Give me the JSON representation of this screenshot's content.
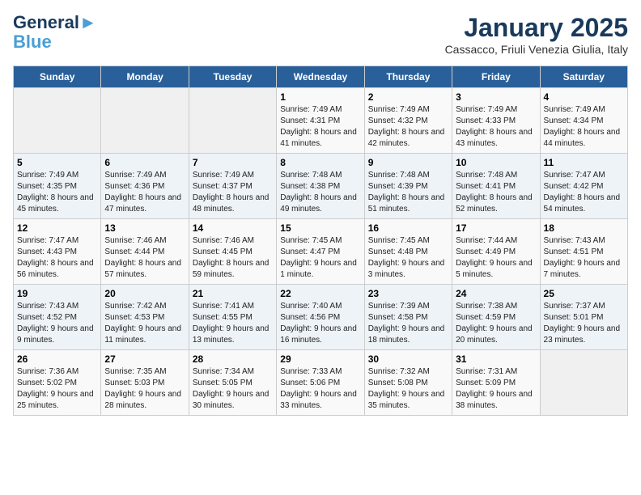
{
  "header": {
    "logo_line1": "General",
    "logo_line2": "Blue",
    "month": "January 2025",
    "location": "Cassacco, Friuli Venezia Giulia, Italy"
  },
  "days_of_week": [
    "Sunday",
    "Monday",
    "Tuesday",
    "Wednesday",
    "Thursday",
    "Friday",
    "Saturday"
  ],
  "weeks": [
    [
      {
        "day": "",
        "info": ""
      },
      {
        "day": "",
        "info": ""
      },
      {
        "day": "",
        "info": ""
      },
      {
        "day": "1",
        "info": "Sunrise: 7:49 AM\nSunset: 4:31 PM\nDaylight: 8 hours and 41 minutes."
      },
      {
        "day": "2",
        "info": "Sunrise: 7:49 AM\nSunset: 4:32 PM\nDaylight: 8 hours and 42 minutes."
      },
      {
        "day": "3",
        "info": "Sunrise: 7:49 AM\nSunset: 4:33 PM\nDaylight: 8 hours and 43 minutes."
      },
      {
        "day": "4",
        "info": "Sunrise: 7:49 AM\nSunset: 4:34 PM\nDaylight: 8 hours and 44 minutes."
      }
    ],
    [
      {
        "day": "5",
        "info": "Sunrise: 7:49 AM\nSunset: 4:35 PM\nDaylight: 8 hours and 45 minutes."
      },
      {
        "day": "6",
        "info": "Sunrise: 7:49 AM\nSunset: 4:36 PM\nDaylight: 8 hours and 47 minutes."
      },
      {
        "day": "7",
        "info": "Sunrise: 7:49 AM\nSunset: 4:37 PM\nDaylight: 8 hours and 48 minutes."
      },
      {
        "day": "8",
        "info": "Sunrise: 7:48 AM\nSunset: 4:38 PM\nDaylight: 8 hours and 49 minutes."
      },
      {
        "day": "9",
        "info": "Sunrise: 7:48 AM\nSunset: 4:39 PM\nDaylight: 8 hours and 51 minutes."
      },
      {
        "day": "10",
        "info": "Sunrise: 7:48 AM\nSunset: 4:41 PM\nDaylight: 8 hours and 52 minutes."
      },
      {
        "day": "11",
        "info": "Sunrise: 7:47 AM\nSunset: 4:42 PM\nDaylight: 8 hours and 54 minutes."
      }
    ],
    [
      {
        "day": "12",
        "info": "Sunrise: 7:47 AM\nSunset: 4:43 PM\nDaylight: 8 hours and 56 minutes."
      },
      {
        "day": "13",
        "info": "Sunrise: 7:46 AM\nSunset: 4:44 PM\nDaylight: 8 hours and 57 minutes."
      },
      {
        "day": "14",
        "info": "Sunrise: 7:46 AM\nSunset: 4:45 PM\nDaylight: 8 hours and 59 minutes."
      },
      {
        "day": "15",
        "info": "Sunrise: 7:45 AM\nSunset: 4:47 PM\nDaylight: 9 hours and 1 minute."
      },
      {
        "day": "16",
        "info": "Sunrise: 7:45 AM\nSunset: 4:48 PM\nDaylight: 9 hours and 3 minutes."
      },
      {
        "day": "17",
        "info": "Sunrise: 7:44 AM\nSunset: 4:49 PM\nDaylight: 9 hours and 5 minutes."
      },
      {
        "day": "18",
        "info": "Sunrise: 7:43 AM\nSunset: 4:51 PM\nDaylight: 9 hours and 7 minutes."
      }
    ],
    [
      {
        "day": "19",
        "info": "Sunrise: 7:43 AM\nSunset: 4:52 PM\nDaylight: 9 hours and 9 minutes."
      },
      {
        "day": "20",
        "info": "Sunrise: 7:42 AM\nSunset: 4:53 PM\nDaylight: 9 hours and 11 minutes."
      },
      {
        "day": "21",
        "info": "Sunrise: 7:41 AM\nSunset: 4:55 PM\nDaylight: 9 hours and 13 minutes."
      },
      {
        "day": "22",
        "info": "Sunrise: 7:40 AM\nSunset: 4:56 PM\nDaylight: 9 hours and 16 minutes."
      },
      {
        "day": "23",
        "info": "Sunrise: 7:39 AM\nSunset: 4:58 PM\nDaylight: 9 hours and 18 minutes."
      },
      {
        "day": "24",
        "info": "Sunrise: 7:38 AM\nSunset: 4:59 PM\nDaylight: 9 hours and 20 minutes."
      },
      {
        "day": "25",
        "info": "Sunrise: 7:37 AM\nSunset: 5:01 PM\nDaylight: 9 hours and 23 minutes."
      }
    ],
    [
      {
        "day": "26",
        "info": "Sunrise: 7:36 AM\nSunset: 5:02 PM\nDaylight: 9 hours and 25 minutes."
      },
      {
        "day": "27",
        "info": "Sunrise: 7:35 AM\nSunset: 5:03 PM\nDaylight: 9 hours and 28 minutes."
      },
      {
        "day": "28",
        "info": "Sunrise: 7:34 AM\nSunset: 5:05 PM\nDaylight: 9 hours and 30 minutes."
      },
      {
        "day": "29",
        "info": "Sunrise: 7:33 AM\nSunset: 5:06 PM\nDaylight: 9 hours and 33 minutes."
      },
      {
        "day": "30",
        "info": "Sunrise: 7:32 AM\nSunset: 5:08 PM\nDaylight: 9 hours and 35 minutes."
      },
      {
        "day": "31",
        "info": "Sunrise: 7:31 AM\nSunset: 5:09 PM\nDaylight: 9 hours and 38 minutes."
      },
      {
        "day": "",
        "info": ""
      }
    ]
  ]
}
